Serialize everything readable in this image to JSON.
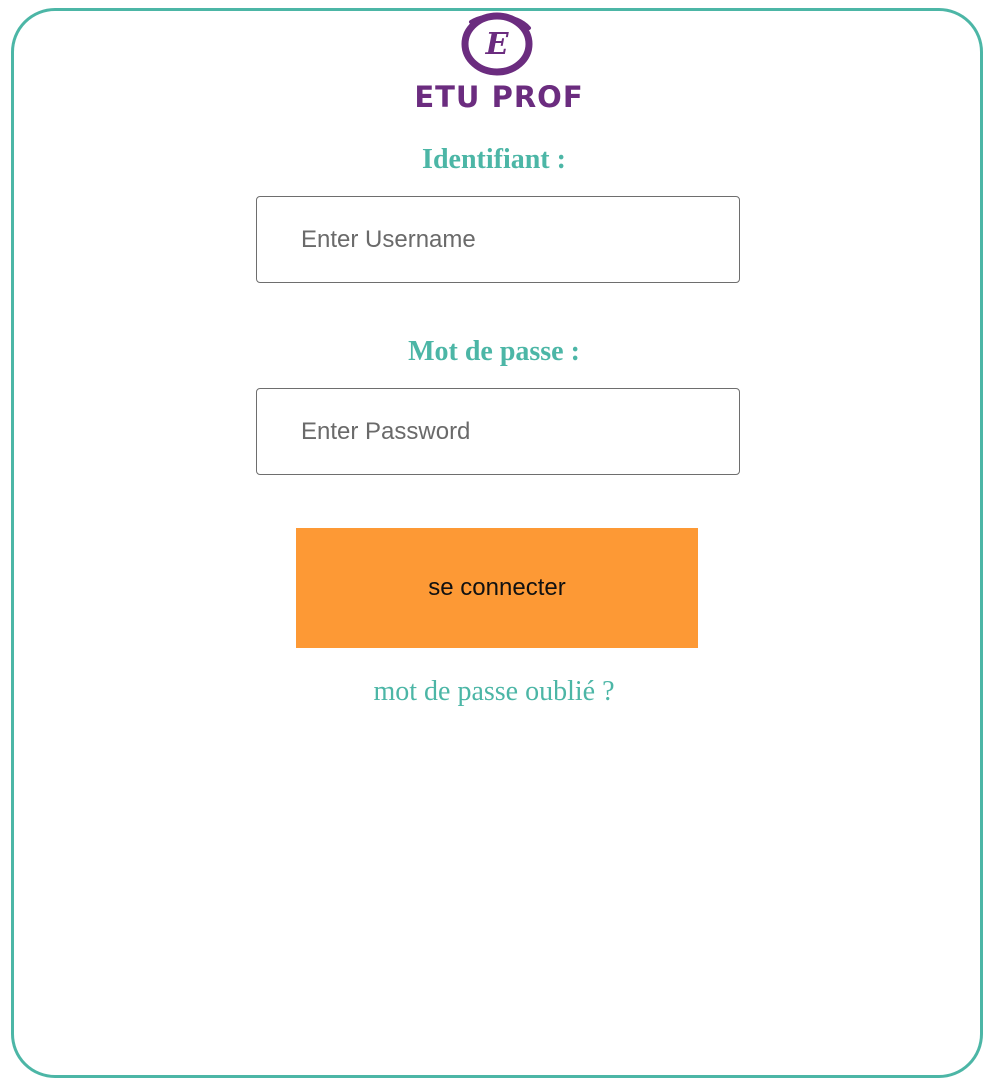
{
  "logo": {
    "letter": "E",
    "text": "ETU PROF",
    "brand_color": "#6b2c7f"
  },
  "form": {
    "username_label": "Identifiant :",
    "username_placeholder": "Enter Username",
    "username_value": "",
    "password_label": "Mot de passe :",
    "password_placeholder": "Enter Password",
    "password_value": "",
    "submit_label": "se connecter",
    "forgot_label": "mot de passe oublié ?"
  },
  "colors": {
    "accent": "#4cb6a6",
    "button": "#fd9935",
    "border": "#4cb6a6"
  }
}
